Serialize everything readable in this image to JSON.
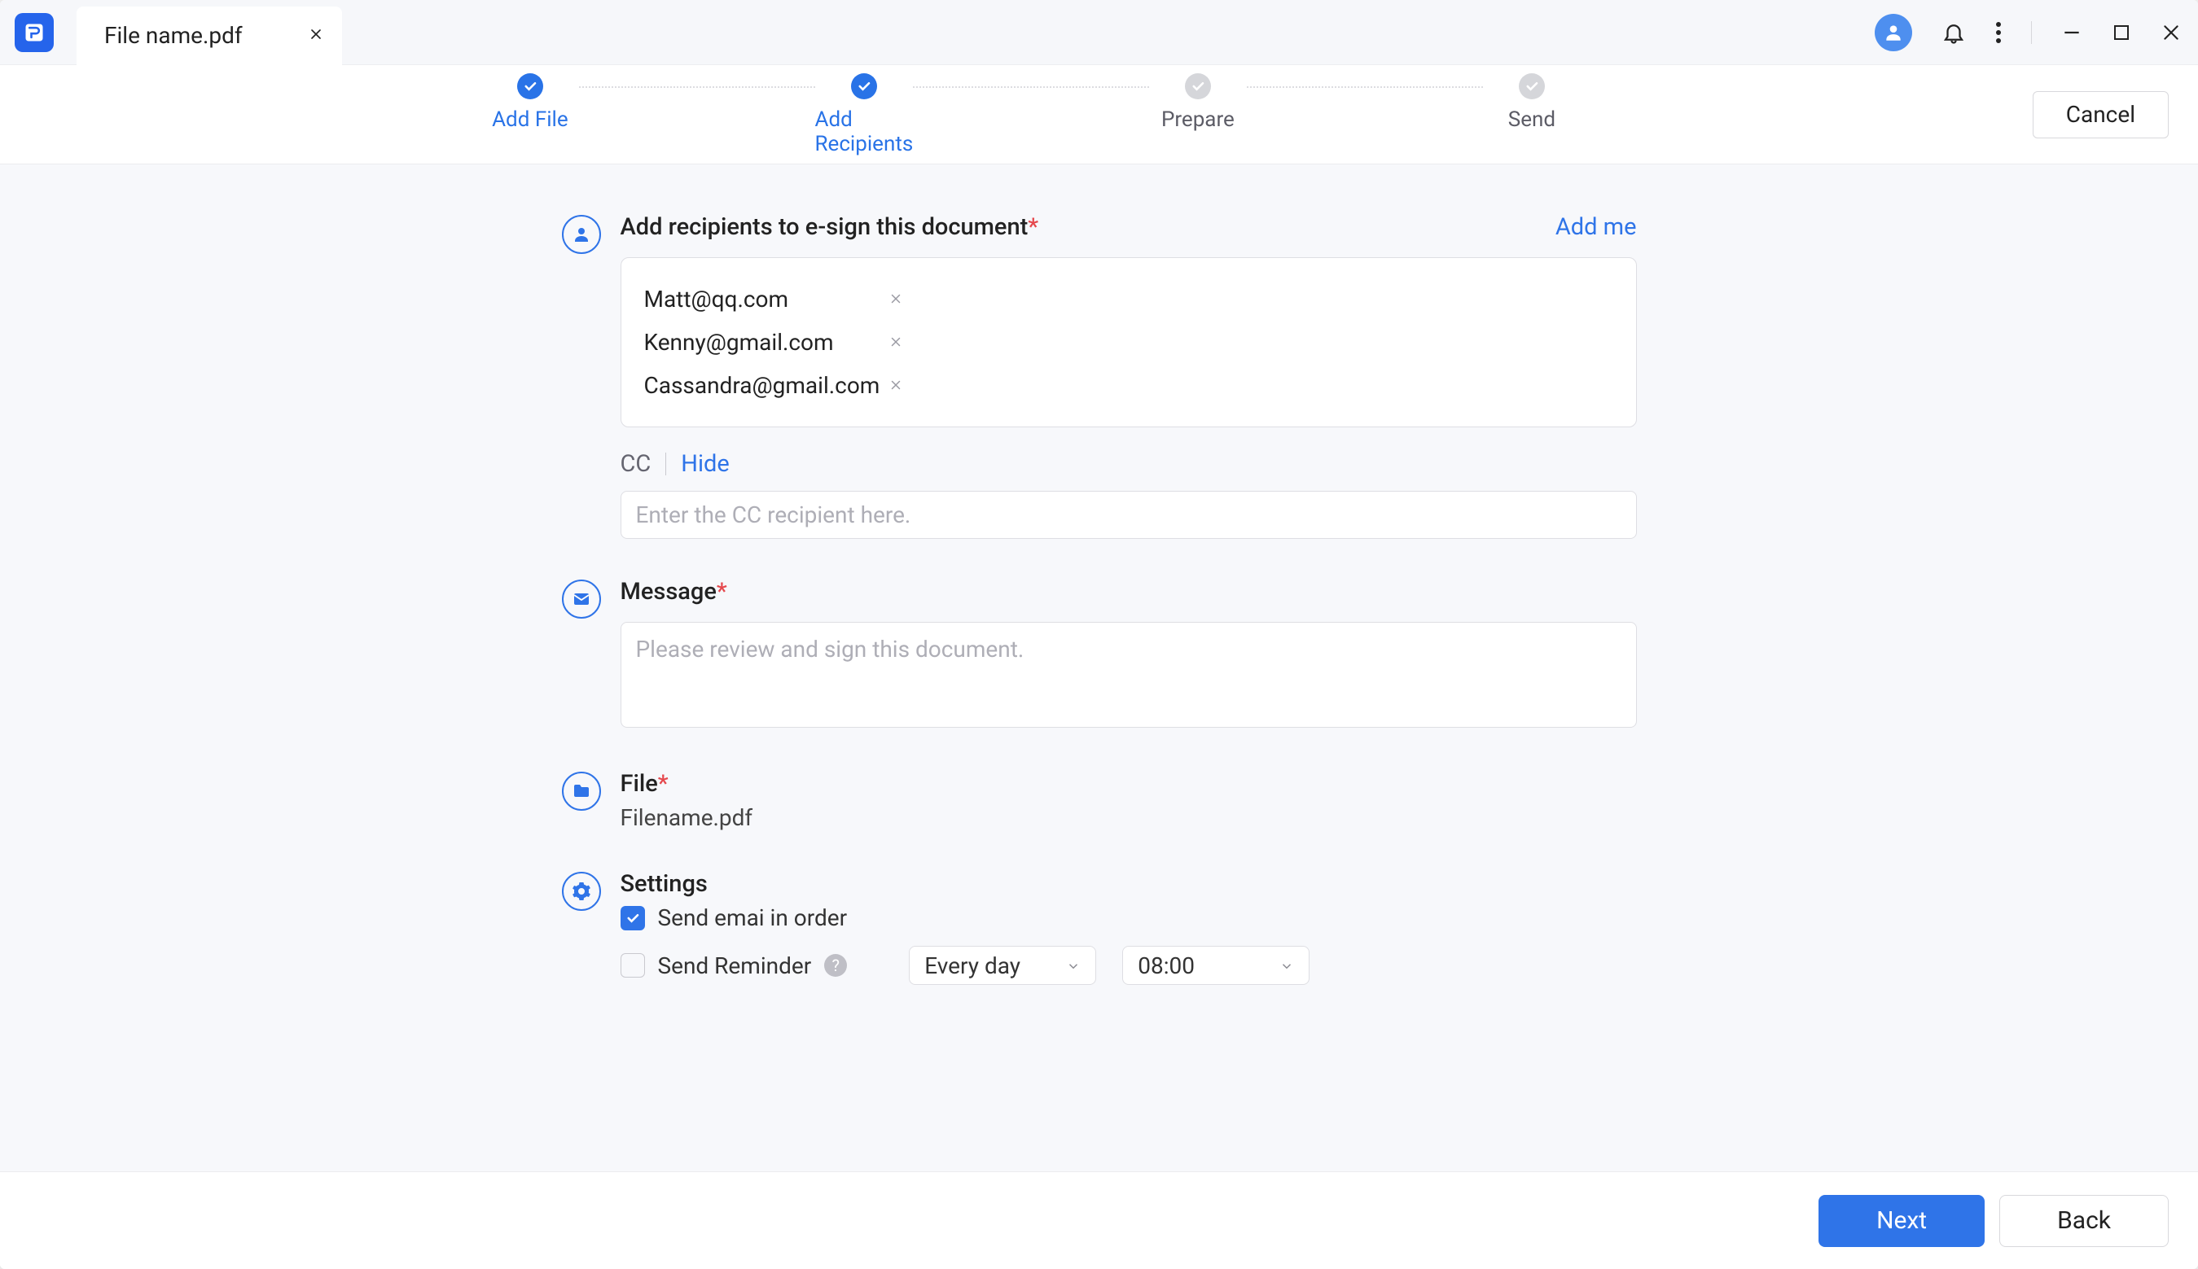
{
  "tab": {
    "filename": "File name.pdf"
  },
  "stepper": {
    "steps": [
      {
        "label": "Add File",
        "state": "done"
      },
      {
        "label": "Add Recipients",
        "state": "active"
      },
      {
        "label": "Prepare",
        "state": "pending"
      },
      {
        "label": "Send",
        "state": "pending"
      }
    ],
    "cancel": "Cancel"
  },
  "recipients": {
    "title": "Add recipients to e-sign this document",
    "required": "*",
    "add_me": "Add me",
    "list": [
      "Matt@qq.com",
      "Kenny@gmail.com",
      "Cassandra@gmail.com"
    ],
    "cc_label": "CC",
    "cc_toggle": "Hide",
    "cc_placeholder": "Enter the CC recipient here."
  },
  "message": {
    "title": "Message",
    "required": "*",
    "placeholder": "Please review and sign this document."
  },
  "file": {
    "title": "File",
    "required": "*",
    "name": "Filename.pdf"
  },
  "settings": {
    "title": "Settings",
    "send_in_order": {
      "label": "Send emai in order",
      "checked": true
    },
    "send_reminder": {
      "label": "Send Reminder",
      "checked": false
    },
    "frequency": "Every day",
    "time": "08:00"
  },
  "footer": {
    "next": "Next",
    "back": "Back"
  }
}
